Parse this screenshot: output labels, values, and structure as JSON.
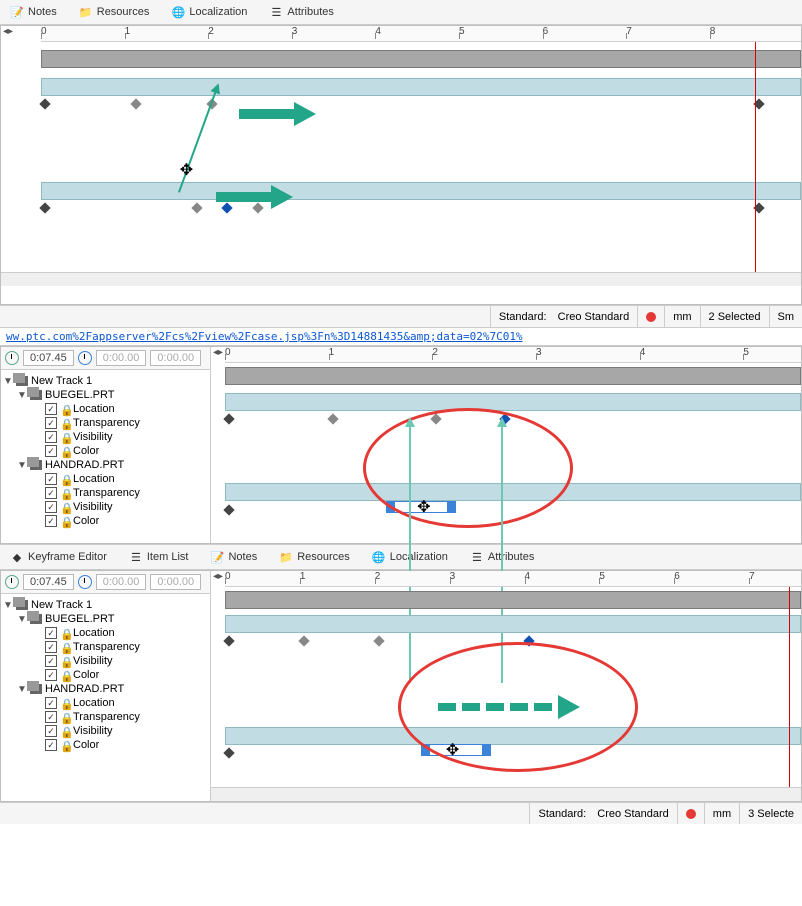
{
  "tabs_top": {
    "notes": "Notes",
    "resources": "Resources",
    "localization": "Localization",
    "attributes": "Attributes"
  },
  "tabs_mid": {
    "keyframe_editor": "Keyframe Editor",
    "item_list": "Item List",
    "notes": "Notes",
    "resources": "Resources",
    "localization": "Localization",
    "attributes": "Attributes"
  },
  "ruler_ticks": [
    "0",
    "1",
    "2",
    "3",
    "4",
    "5",
    "6",
    "7",
    "8"
  ],
  "ruler_ticks_b": [
    "0",
    "1",
    "2",
    "3",
    "4",
    "5"
  ],
  "ruler_ticks_c": [
    "0",
    "1",
    "2",
    "3",
    "4",
    "5",
    "6",
    "7"
  ],
  "status_a": {
    "standard_label": "Standard:",
    "standard_value": "Creo Standard",
    "units": "mm",
    "selected": "2 Selected",
    "extra": "Sm"
  },
  "status_b": {
    "standard_label": "Standard:",
    "standard_value": "Creo Standard",
    "units": "mm",
    "selected": "3 Selecte"
  },
  "url": "ww.ptc.com%2Fappserver%2Fcs%2Fview%2Fcase.jsp%3Fn%3D14881435&amp;data=02%7C01%",
  "time": {
    "current": "0:07.45",
    "a": "0:00.00",
    "b": "0:00.00"
  },
  "tree": {
    "root": "New Track 1",
    "parts": [
      {
        "name": "BUEGEL.PRT",
        "props": [
          "Location",
          "Transparency",
          "Visibility",
          "Color"
        ]
      },
      {
        "name": "HANDRAD.PRT",
        "props": [
          "Location",
          "Transparency",
          "Visibility",
          "Color"
        ]
      }
    ]
  }
}
